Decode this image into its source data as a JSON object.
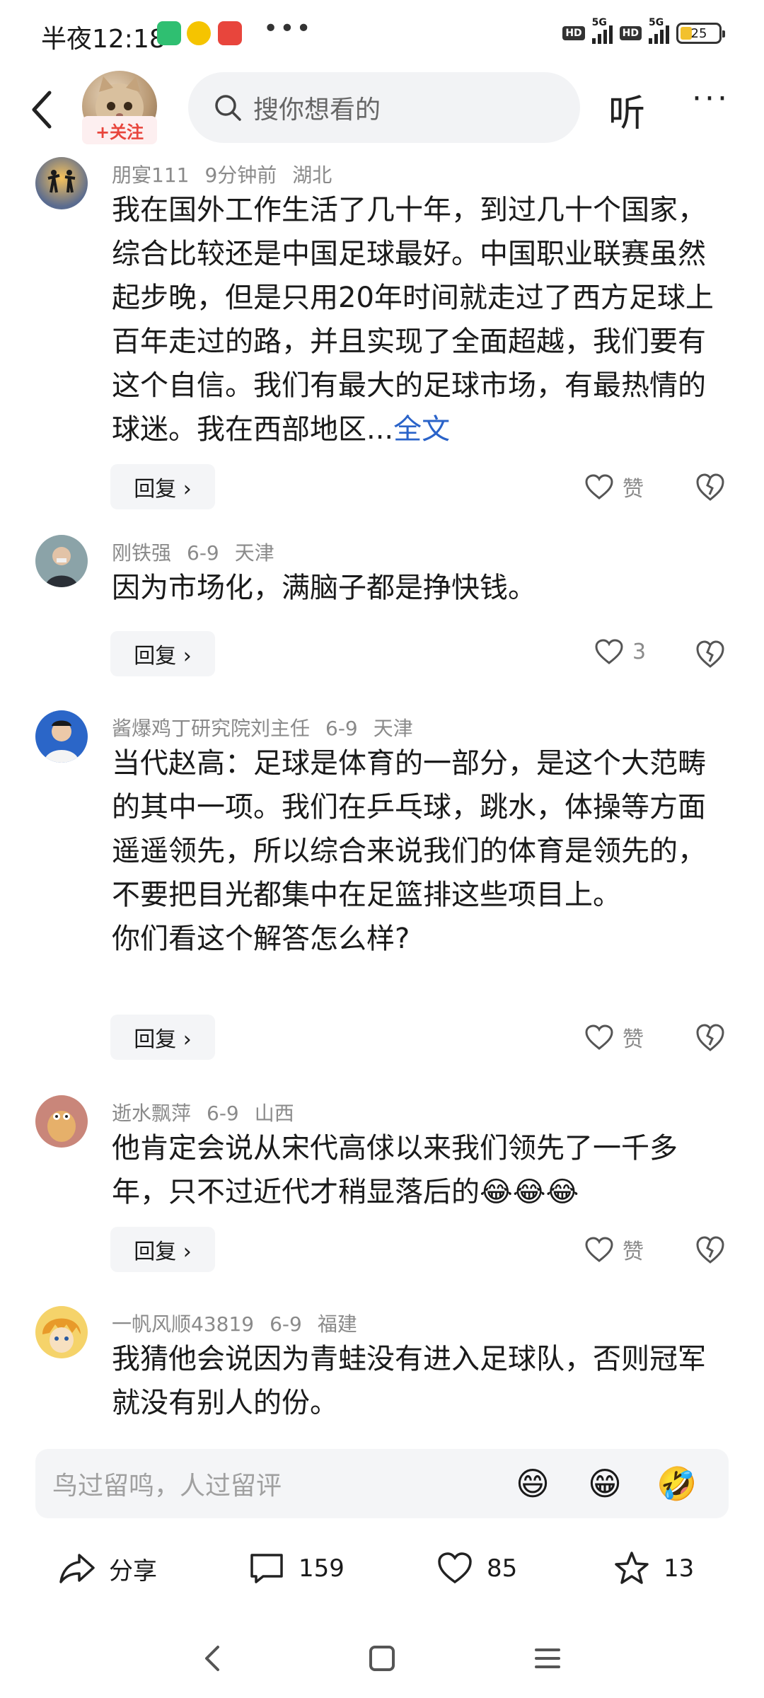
{
  "status_bar": {
    "time": "半夜12:18",
    "more": "•••",
    "signal_label": "5G",
    "hd_label": "HD",
    "battery": "25"
  },
  "top_nav": {
    "follow_label": "+关注",
    "search_placeholder": "搜你想看的",
    "listen_label": "听",
    "more_label": "···"
  },
  "comments": [
    {
      "username": "朋宴111",
      "time": "9分钟前",
      "location": "湖北",
      "text": "我在国外工作生活了几十年，到过几十个国家，综合比较还是中国足球最好。中国职业联赛虽然起步晚，但是只用20年时间就走过了西方足球上百年走过的路，并且实现了全面超越，我们要有这个自信。我们有最大的足球市场，有最热情的球迷。我在西部地区...",
      "fulltext_link": "全文",
      "reply_label": "回复 ›",
      "like_label": "赞"
    },
    {
      "username": "刚铁强",
      "time": "6-9",
      "location": "天津",
      "text": "因为市场化，满脑子都是挣快钱。",
      "reply_label": "回复 ›",
      "like_label": "3"
    },
    {
      "username": "酱爆鸡丁研究院刘主任",
      "time": "6-9",
      "location": "天津",
      "text": "当代赵高：足球是体育的一部分，是这个大范畴的其中一项。我们在乒乓球，跳水，体操等方面遥遥领先，所以综合来说我们的体育是领先的，不要把目光都集中在足篮排这些项目上。\n你们看这个解答怎么样?",
      "reply_label": "回复 ›",
      "like_label": "赞"
    },
    {
      "username": "逝水飘萍",
      "time": "6-9",
      "location": "山西",
      "text": "他肯定会说从宋代高俅以来我们领先了一千多年，只不过近代才稍显落后的😂😂😂",
      "reply_label": "回复 ›",
      "like_label": "赞"
    },
    {
      "username": "一帆风顺43819",
      "time": "6-9",
      "location": "福建",
      "text": "我猜他会说因为青蛙没有进入足球队，否则冠军就没有别人的份。"
    }
  ],
  "input_bar": {
    "placeholder": "鸟过留鸣，人过留评",
    "emojis": [
      "😄",
      "😁",
      "🤣"
    ]
  },
  "action_bar": {
    "share_label": "分享",
    "comment_count": "159",
    "like_count": "85",
    "favorite_count": "13"
  }
}
